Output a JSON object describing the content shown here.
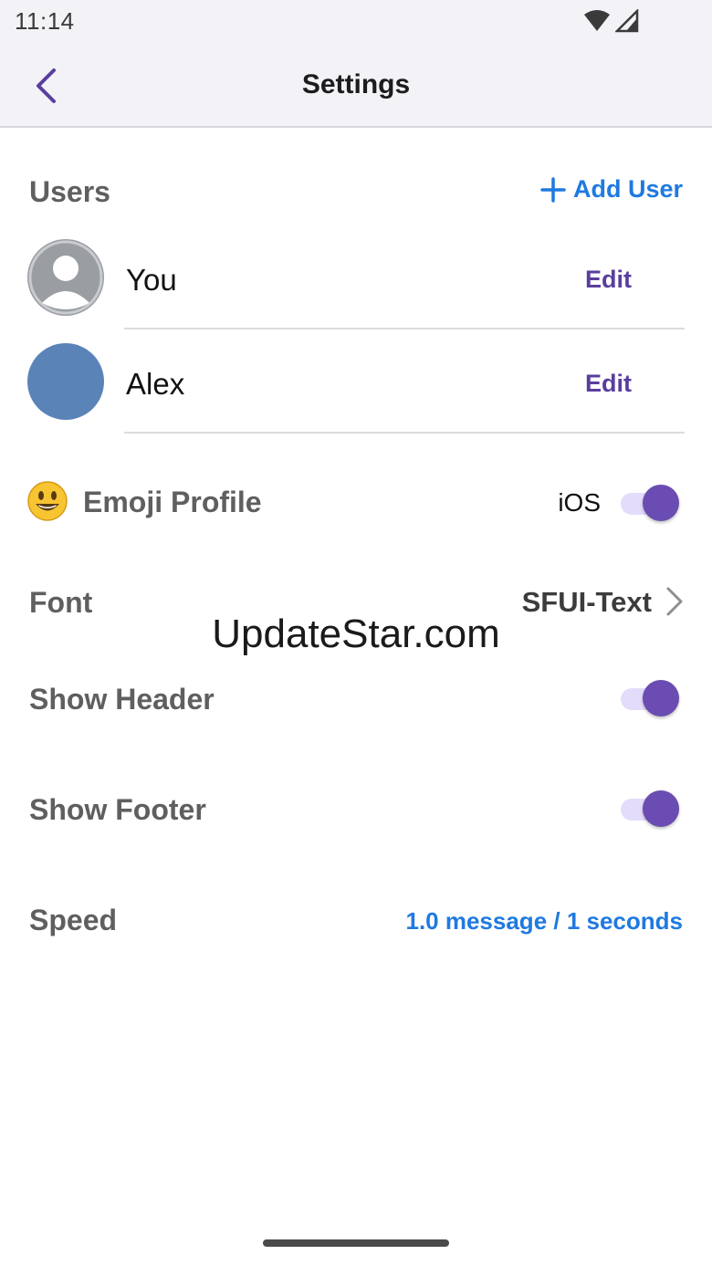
{
  "status_bar": {
    "time": "11:14"
  },
  "nav": {
    "title": "Settings"
  },
  "users_section": {
    "label": "Users",
    "add_user_label": "Add User",
    "users": [
      {
        "name": "You",
        "edit_label": "Edit"
      },
      {
        "name": "Alex",
        "edit_label": "Edit"
      }
    ]
  },
  "settings": {
    "emoji_profile": {
      "label": "Emoji Profile",
      "value": "iOS",
      "enabled": true
    },
    "font": {
      "label": "Font",
      "value": "SFUI-Text"
    },
    "show_header": {
      "label": "Show Header",
      "enabled": true
    },
    "show_footer": {
      "label": "Show Footer",
      "enabled": true
    },
    "speed": {
      "label": "Speed",
      "value": "1.0 message / 1 seconds"
    }
  },
  "watermark": "UpdateStar.com",
  "colors": {
    "accent_purple": "#6a4cb2",
    "link_blue": "#1f7ae0",
    "toggle_track": "#e4dcfb"
  }
}
